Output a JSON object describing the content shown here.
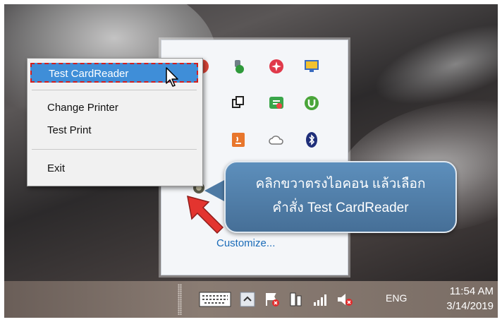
{
  "context_menu": {
    "items": [
      {
        "label": "Test CardReader",
        "highlighted": true
      },
      {
        "label": "Change Printer",
        "highlighted": false
      },
      {
        "label": "Test Print",
        "highlighted": false
      },
      {
        "label": "Exit",
        "highlighted": false
      }
    ]
  },
  "tray_panel": {
    "customize_label": "Customize...",
    "icons": [
      "red-app-icon",
      "usb-device-icon",
      "red-star-icon",
      "monitor-icon",
      "copy-icon",
      "green-chat-icon",
      "utorrent-icon",
      "java-icon",
      "cloud-icon",
      "bluetooth-icon",
      "cardreader-app-icon"
    ]
  },
  "callout": {
    "line1": "คลิกขวาตรงไอคอน แล้วเลือก",
    "line2": "คำสั่ง Test CardReader"
  },
  "taskbar": {
    "language": "ENG",
    "time": "11:54 AM",
    "date": "3/14/2019",
    "icons": [
      "keyboard-icon",
      "show-hidden-icons-icon",
      "action-center-flag-icon",
      "device-icon",
      "network-signal-icon",
      "volume-muted-icon"
    ]
  },
  "colors": {
    "menu_highlight": "#3f8ed8",
    "callout": "#5d8fbc",
    "arrow": "#e3342f",
    "taskbar": "#7a6d65"
  }
}
